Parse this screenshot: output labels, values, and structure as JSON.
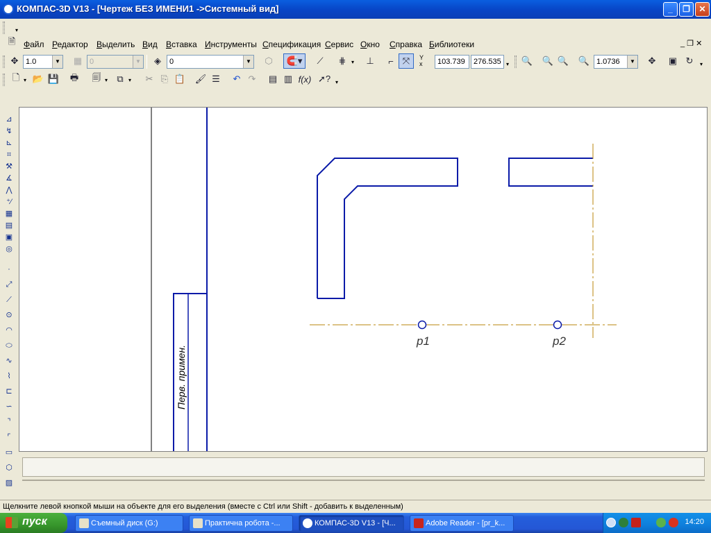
{
  "window": {
    "title": "КОМПАС-3D V13 - [Чертеж БЕЗ ИМЕНИ1 ->Системный вид]",
    "minimize": "_",
    "restore": "❐",
    "close": "✕"
  },
  "menu": {
    "items": [
      "Файл",
      "Редактор",
      "Выделить",
      "Вид",
      "Вставка",
      "Инструменты",
      "Спецификация",
      "Сервис",
      "Окно",
      "Справка",
      "Библиотеки"
    ],
    "doc_controls": "_ ❐ ✕"
  },
  "toolbar_current": {
    "step_value": "1.0",
    "angle_value": "0",
    "layer_value": "0",
    "coord_x": "103.739",
    "coord_y": "276.535",
    "zoom_value": "1.0736"
  },
  "drawing": {
    "stamp_text": "Перв. примен.",
    "point1_label": "p1",
    "point2_label": "p2"
  },
  "status": {
    "hint": "Щелкните левой кнопкой мыши на объекте для его выделения (вместе с Ctrl или Shift - добавить к выделенным)"
  },
  "taskbar": {
    "start_label": "пуск",
    "tasks": [
      {
        "label": "Съемный диск (G:)"
      },
      {
        "label": "Практична робота -..."
      },
      {
        "label": "КОМПАС-3D V13 - [Ч..."
      },
      {
        "label": "Adobe Reader - [pr_k..."
      }
    ],
    "clock": "14:20"
  },
  "colors": {
    "drawing_line": "#0a1aa8",
    "axis_line": "#b8860b",
    "xp_blue": "#245edb"
  }
}
